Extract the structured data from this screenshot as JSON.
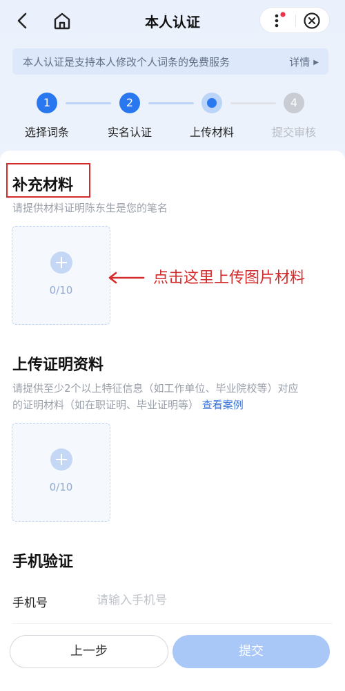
{
  "nav": {
    "title": "本人认证",
    "icons": [
      "chevron-left-icon",
      "home-icon",
      "more-vertical-icon",
      "close-circle-icon"
    ],
    "badge_color": "#e8334a"
  },
  "notice": {
    "text": "本人认证是支持本人修改个人词条的免费服务",
    "detail": "详情"
  },
  "steps": [
    {
      "number": "1",
      "label": "选择词条",
      "state": "done"
    },
    {
      "number": "2",
      "label": "实名认证",
      "state": "done"
    },
    {
      "number": "3",
      "label": "上传材料",
      "state": "current"
    },
    {
      "number": "4",
      "label": "提交审核",
      "state": "todo"
    }
  ],
  "supplement": {
    "title": "补充材料",
    "desc": "请提供材料证明陈东生是您的笔名",
    "count": "0/10"
  },
  "annotation": {
    "text": "点击这里上传图片材料",
    "color": "#d32b2b"
  },
  "proof": {
    "title": "上传证明资料",
    "desc_line1": "请提供至少2个以上特征信息（如工作单位、毕业院校等）对应",
    "desc_line2": "的证明材料（如在职证明、毕业证明等）",
    "link": "查看案例",
    "count": "0/10"
  },
  "phone": {
    "title": "手机验证",
    "label": "手机号",
    "placeholder": "请输入手机号",
    "value": ""
  },
  "buttons": {
    "prev": "上一步",
    "submit": "提交"
  },
  "colors": {
    "accent": "#2a78f0",
    "submit_disabled": "#a9c7f7"
  }
}
